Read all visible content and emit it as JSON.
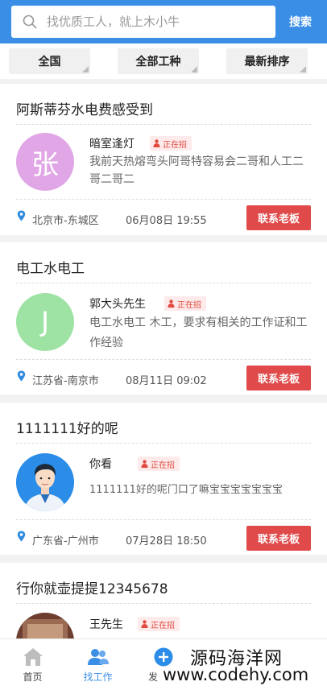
{
  "search": {
    "placeholder": "找优质工人，就上木小牛",
    "button_label": "搜索"
  },
  "filters": [
    {
      "label": "全国"
    },
    {
      "label": "全部工种"
    },
    {
      "label": "最新排序"
    }
  ],
  "jobs": [
    {
      "title": "阿斯蒂芬水电费感受到",
      "avatar_text": "张",
      "avatar_color": "#e1a6e6",
      "name": "暗室逢灯",
      "badge": "正在招",
      "desc": "我前天热熔弯头阿哥特容易会二哥和人工二哥二哥二",
      "location": "北京市-东城区",
      "time": "06月08日 19:55",
      "contact_label": "联系老板"
    },
    {
      "title": "电工水电工",
      "avatar_text": "J",
      "avatar_color": "#9ee3a3",
      "name": "郭大头先生",
      "badge": "正在招",
      "desc": "电工水电工 木工，要求有相关的工作证和工作经验",
      "location": "江苏省-南京市",
      "time": "08月11日 09:02",
      "contact_label": "联系老板"
    },
    {
      "title": "1111111好的呢",
      "avatar_text": "",
      "avatar_color": "#2b8de8",
      "name": "你看",
      "badge": "正在招",
      "desc": "1111111好的呢门口了嘛宝宝宝宝宝宝宝",
      "location": "广东省-广州市",
      "time": "07月28日 18:50",
      "contact_label": "联系老板"
    },
    {
      "title": "行你就壶提提12345678",
      "avatar_text": "",
      "avatar_color": "#7a4a3a",
      "name": "王先生",
      "badge": "正在招"
    }
  ],
  "tabbar": {
    "items": [
      {
        "label": "首页",
        "icon": "home-icon"
      },
      {
        "label": "找工作",
        "icon": "people-icon"
      },
      {
        "label": "发",
        "icon": "plus-circle-icon"
      }
    ],
    "active_color": "#3a8ee6"
  },
  "watermark": {
    "line1": "源码海洋网",
    "line2": "www.codehy.com"
  },
  "colors": {
    "header": "#3a8ee6",
    "contact_button": "#e04a4a",
    "badge_text": "#e04a3f"
  }
}
